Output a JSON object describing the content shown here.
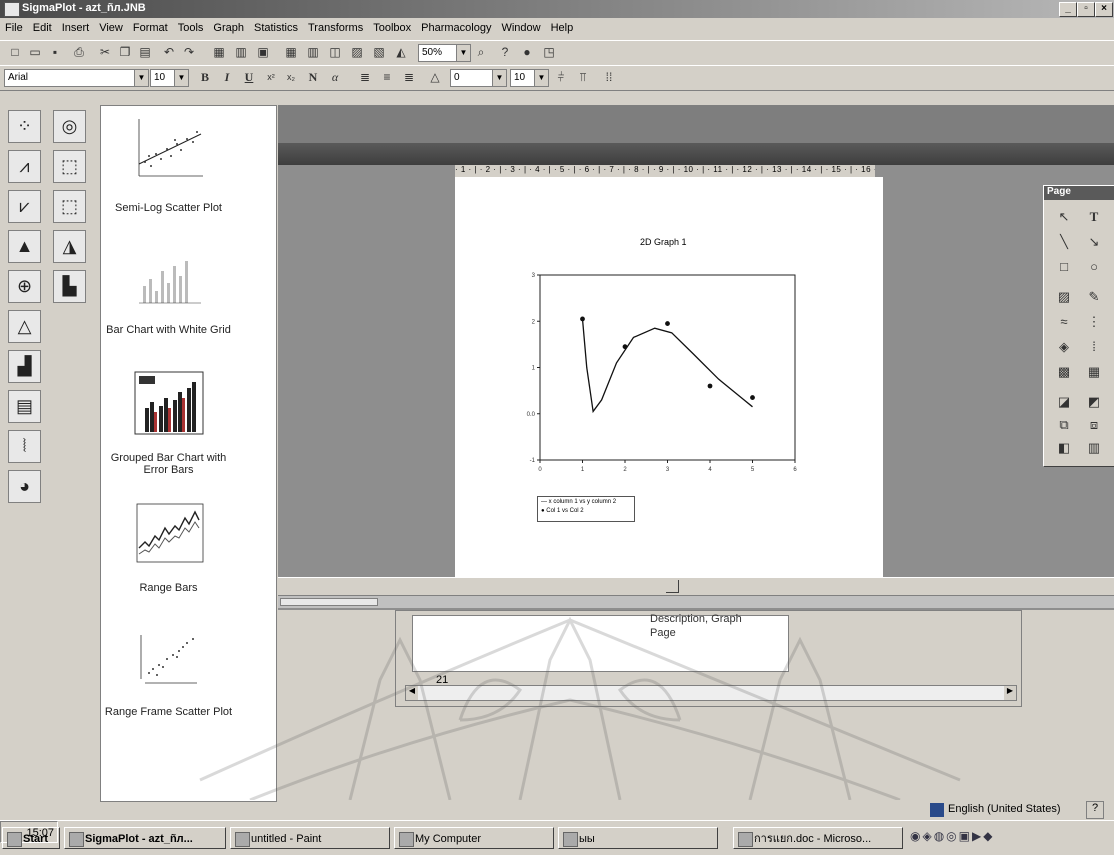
{
  "window": {
    "title": "SigmaPlot - azt_ñл.JNB"
  },
  "menu": [
    "File",
    "Edit",
    "Insert",
    "View",
    "Format",
    "Tools",
    "Graph",
    "Statistics",
    "Transforms",
    "Toolbox",
    "Pharmacology",
    "Window",
    "Help"
  ],
  "toolbar": {
    "zoom": "50%"
  },
  "format_toolbar": {
    "font": "Arial",
    "size": "10",
    "size2": "10",
    "bold": "B",
    "italic": "I",
    "underline": "U",
    "normal": "N",
    "alpha": "α"
  },
  "gallery": [
    {
      "label": "Semi-Log Scatter Plot"
    },
    {
      "label": "Bar Chart with White Grid"
    },
    {
      "label": "Grouped Bar Chart with Error Bars"
    },
    {
      "label": "Range Bars"
    },
    {
      "label": "Range Frame Scatter Plot"
    }
  ],
  "ruler": "· 1 · | · 2 · | · 3 · | · 4 · | · 5 · | · 6 · | · 7 · | · 8 · | · 9 · | · 10 · | · 11 · | · 12 · | · 13 · | · 14 · | · 15 · | · 16 · | · 17 · | · 18 · | · 19 · | · 20 ·",
  "graph": {
    "title": "2D Graph 1",
    "legend": [
      "x column 1 vs y column 2",
      "Col 1 vs Col 2"
    ]
  },
  "chart_data": {
    "type": "scatter",
    "title": "2D Graph 1",
    "xlim": [
      0,
      6
    ],
    "ylim": [
      -1,
      3
    ],
    "x_ticks": [
      "0",
      "1",
      "2",
      "3",
      "4",
      "5",
      "6"
    ],
    "y_ticks": [
      "-1",
      "0.0",
      "1",
      "2",
      "3"
    ],
    "series": [
      {
        "name": "Col 1 vs Col 2",
        "x": [
          1,
          2,
          3,
          4,
          5
        ],
        "y": [
          2.05,
          1.45,
          1.95,
          0.6,
          0.35
        ]
      }
    ],
    "curve": {
      "x": [
        1,
        1.1,
        1.25,
        1.45,
        1.8,
        2.2,
        2.7,
        3.1,
        3.6,
        4.2,
        4.8,
        5.0
      ],
      "y": [
        2.05,
        1.0,
        0.05,
        0.3,
        1.1,
        1.65,
        1.85,
        1.75,
        1.3,
        0.75,
        0.3,
        0.15
      ]
    }
  },
  "toolbox": {
    "title": "Page"
  },
  "notebook": {
    "description": "Description, Graph Page",
    "row": "21"
  },
  "language": "English (United States)",
  "taskbar": {
    "start": "Start",
    "items": [
      "SigmaPlot - azt_ñл...",
      "untitled - Paint",
      "My Computer",
      "ыы",
      "การแยก.doc - Microso..."
    ],
    "clock": "15:07"
  }
}
